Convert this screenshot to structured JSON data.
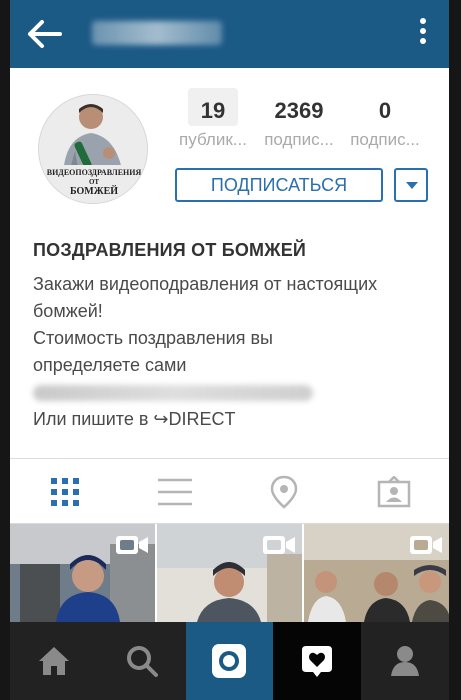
{
  "topbar": {
    "username": "bomzh",
    "back_icon": "arrow-left-icon",
    "menu_icon": "more-vertical-icon"
  },
  "profile": {
    "avatar_caption": [
      "ВИДЕОПОЗДРАВЛЕНИЯ",
      "ОТ",
      "БОМЖЕЙ"
    ],
    "stats": [
      {
        "value": "19",
        "label": "публик..."
      },
      {
        "value": "2369",
        "label": "подпис..."
      },
      {
        "value": "0",
        "label": "подпис..."
      }
    ],
    "follow_label": "ПОДПИСАТЬСЯ",
    "name": "ПОЗДРАВЛЕНИЯ ОТ БОМЖЕЙ",
    "bio_lines": [
      "Закажи видеоподравления от настоящих",
      "бомжей!",
      "Стоимость поздравления вы",
      "определяете сами",
      "",
      "Или пишите в ↪DIRECT"
    ]
  },
  "tabs": [
    "grid-icon",
    "list-icon",
    "location-pin-icon",
    "tagged-user-icon"
  ],
  "nav": [
    "home-icon",
    "search-icon",
    "camera-icon",
    "activity-heart-icon",
    "profile-icon"
  ],
  "colors": {
    "accent": "#1c5a86",
    "button": "#2a6fb0"
  }
}
